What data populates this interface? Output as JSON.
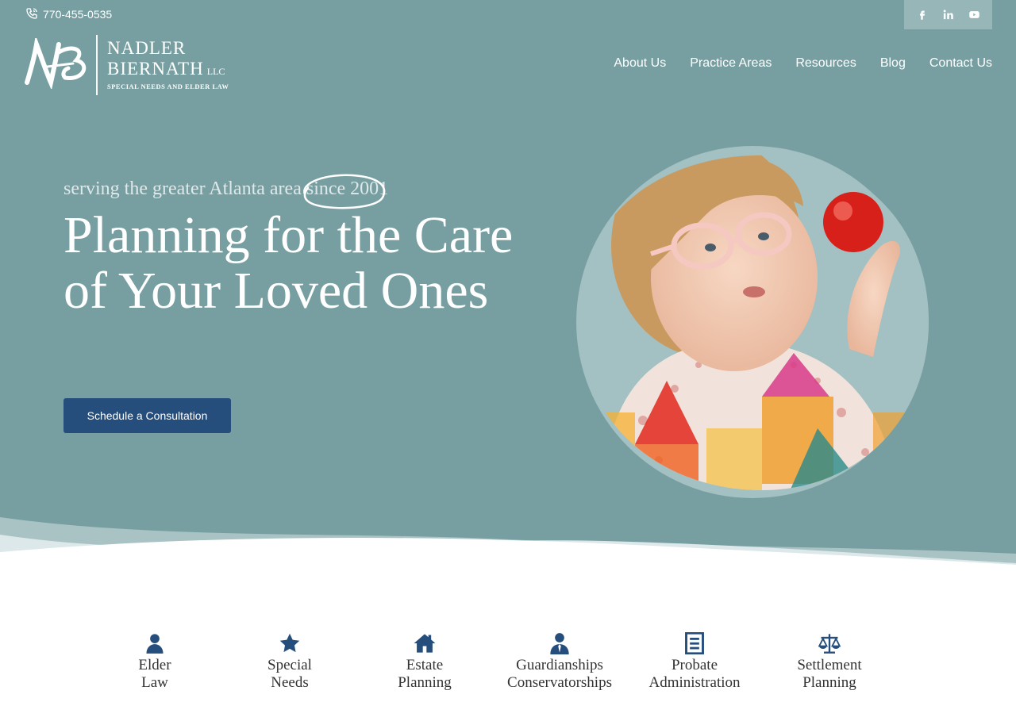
{
  "colors": {
    "hero_bg": "#779fa1",
    "cta_bg": "#264e7c",
    "icon": "#264e7c",
    "nav_text": "#ffffff"
  },
  "header": {
    "phone": "770-455-0535",
    "phone_icon": "phone-icon",
    "social": [
      {
        "name": "facebook",
        "glyph": "f"
      },
      {
        "name": "linkedin",
        "glyph": "in"
      },
      {
        "name": "youtube",
        "glyph": "▶"
      }
    ]
  },
  "logo": {
    "monogram": "NB",
    "line1": "NADLER",
    "line2": "BIERNATH",
    "llc": "LLC",
    "tagline": "Special Needs and Elder Law"
  },
  "nav": {
    "items": [
      {
        "label": "About Us"
      },
      {
        "label": "Practice Areas"
      },
      {
        "label": "Resources"
      },
      {
        "label": "Blog"
      },
      {
        "label": "Contact Us"
      }
    ]
  },
  "hero": {
    "eyebrow": "serving the greater Atlanta area",
    "eyebrow_highlight": "since 2001",
    "title": "Planning for the Care of Your Loved Ones",
    "cta_label": "Schedule a Consultation"
  },
  "services": [
    {
      "icon": "person-icon",
      "line1": "Elder",
      "line2": "Law"
    },
    {
      "icon": "star-icon",
      "line1": "Special",
      "line2": "Needs"
    },
    {
      "icon": "home-icon",
      "line1": "Estate",
      "line2": "Planning"
    },
    {
      "icon": "businessman-icon",
      "line1": "Guardianships",
      "line2": "Conservatorships"
    },
    {
      "icon": "document-icon",
      "line1": "Probate",
      "line2": "Administration"
    },
    {
      "icon": "scales-icon",
      "line1": "Settlement",
      "line2": "Planning"
    }
  ]
}
